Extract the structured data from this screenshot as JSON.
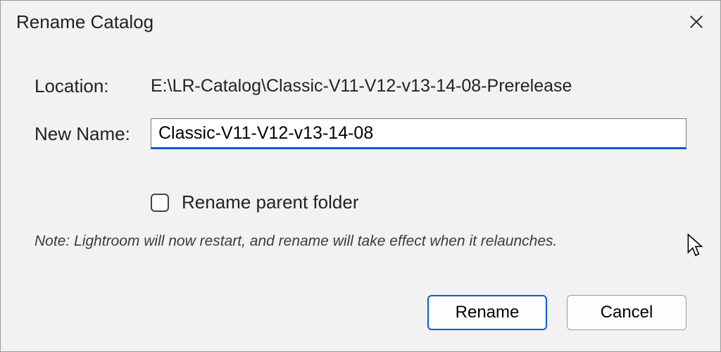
{
  "dialog": {
    "title": "Rename Catalog",
    "location_label": "Location:",
    "location_value": "E:\\LR-Catalog\\Classic-V11-V12-v13-14-08-Prerelease",
    "newname_label": "New Name:",
    "newname_value": "Classic-V11-V12-v13-14-08",
    "checkbox_label": "Rename parent folder",
    "checkbox_checked": false,
    "note": "Note: Lightroom will now restart, and rename will take effect when it relaunches.",
    "rename_button": "Rename",
    "cancel_button": "Cancel"
  }
}
